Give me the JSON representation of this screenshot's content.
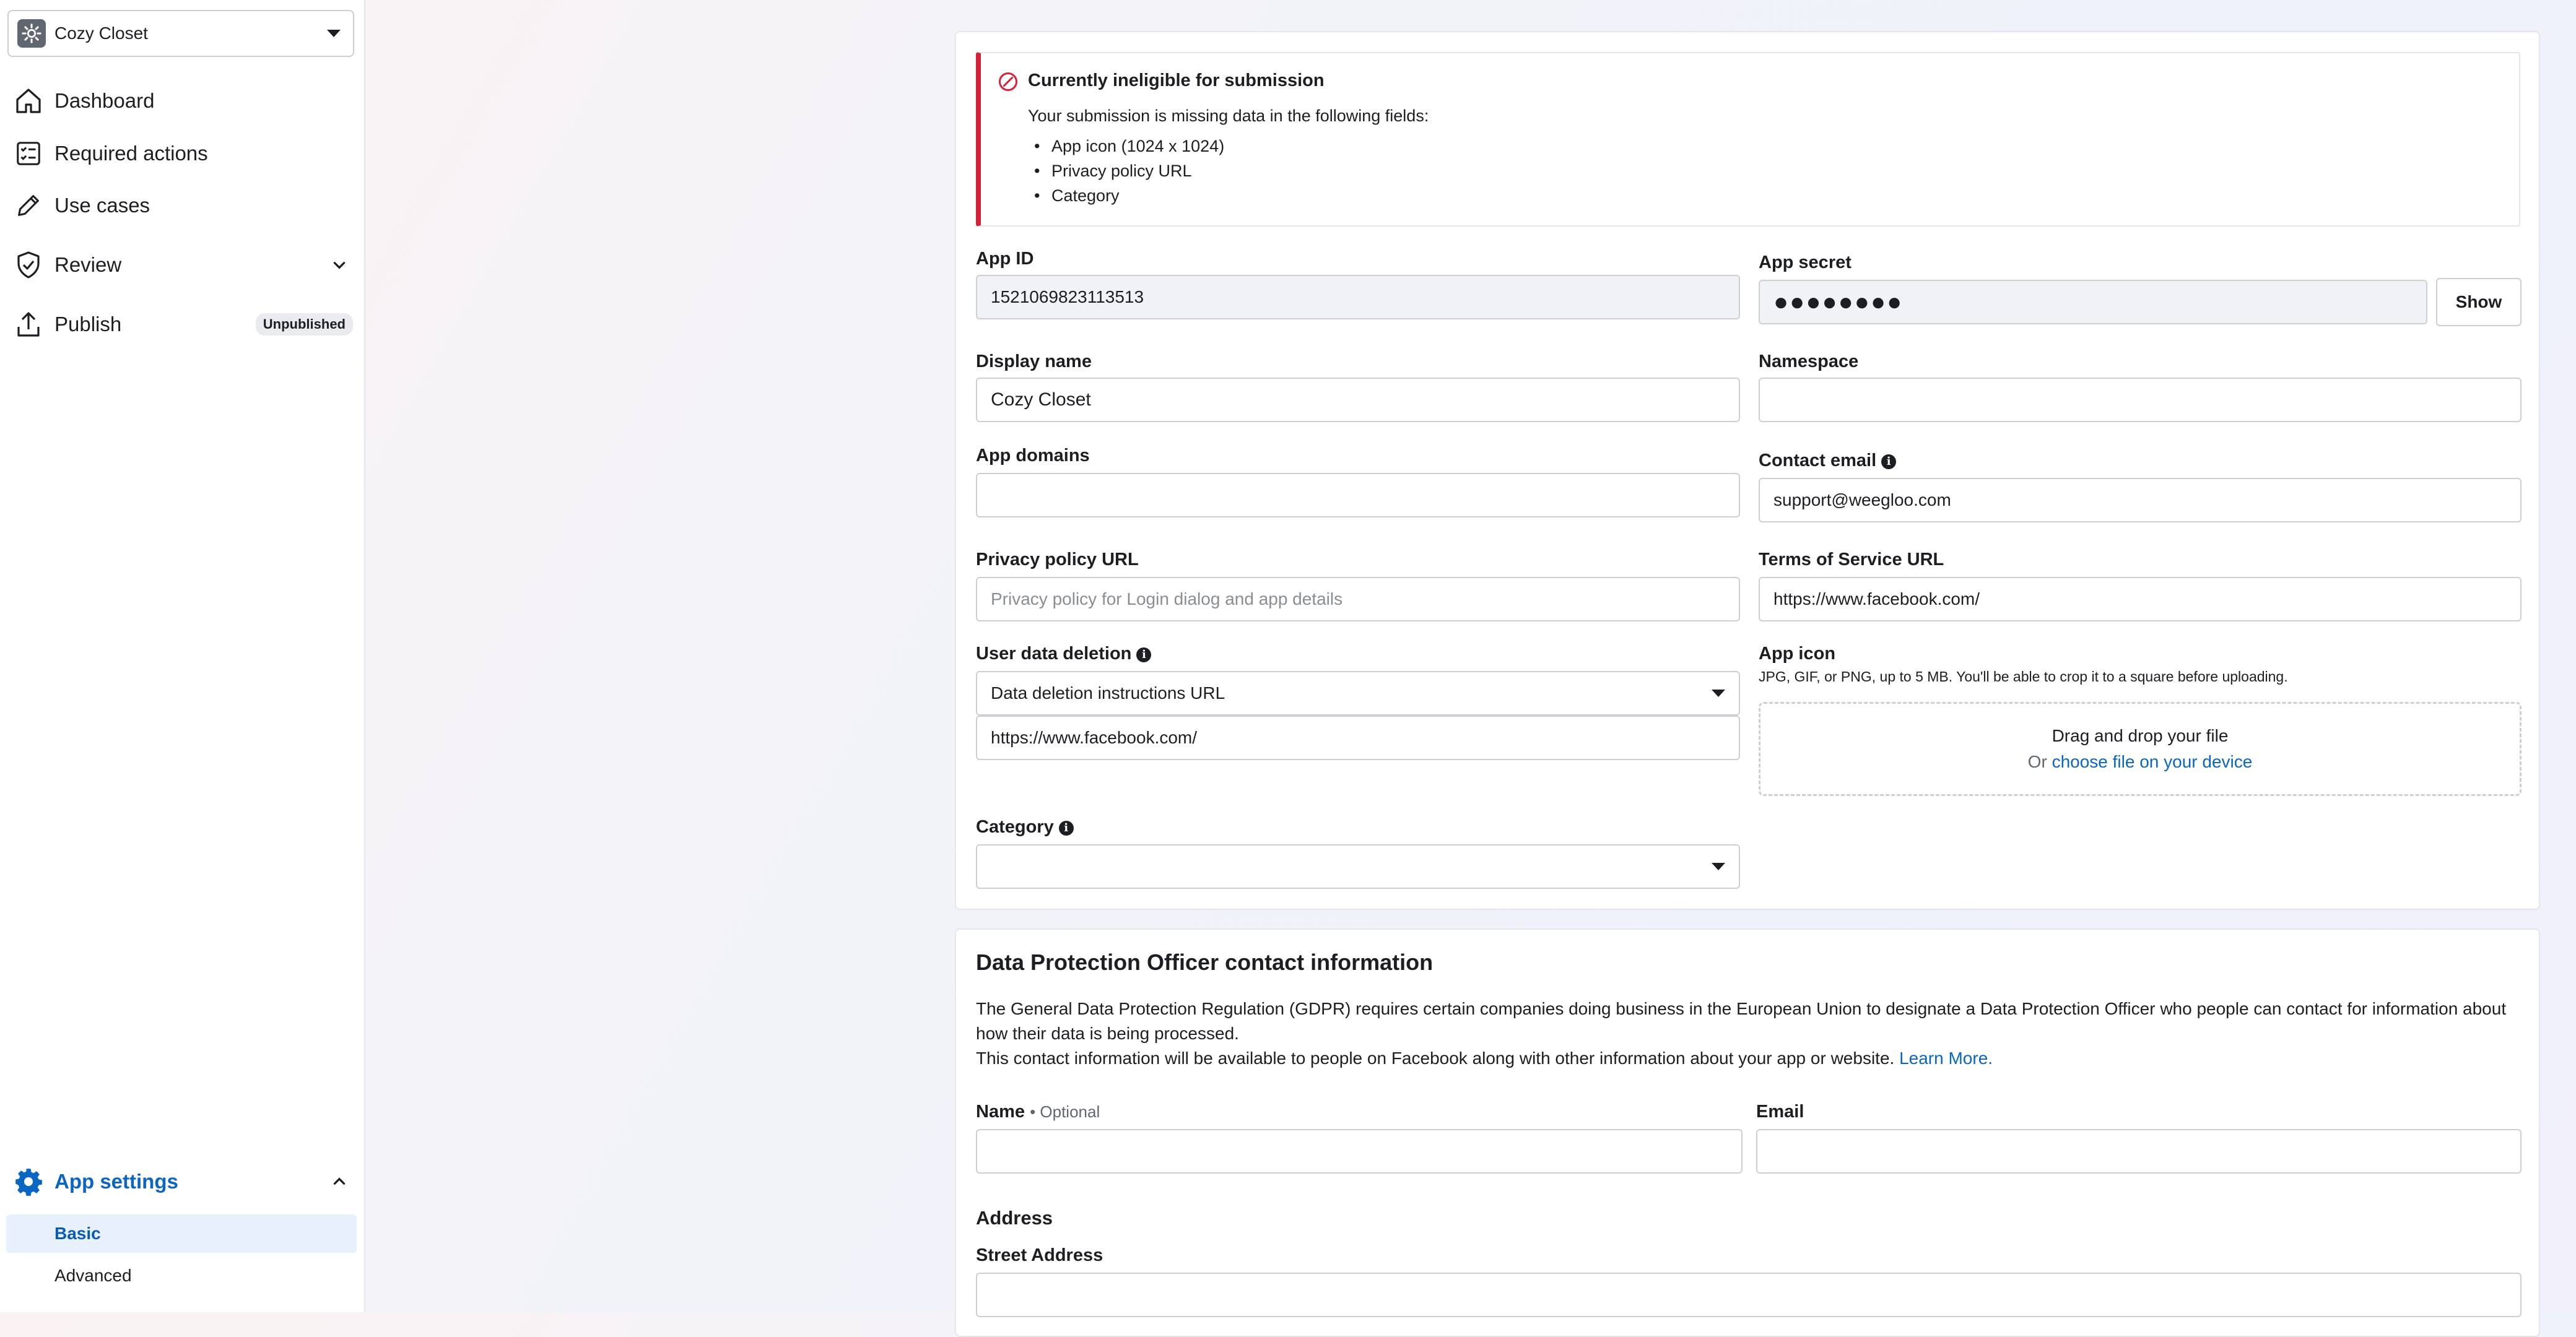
{
  "sidebar": {
    "app_name": "Cozy Closet",
    "nav": [
      {
        "label": "Dashboard",
        "icon": "home-icon"
      },
      {
        "label": "Required actions",
        "icon": "checklist-icon"
      },
      {
        "label": "Use cases",
        "icon": "pencil-icon"
      },
      {
        "label": "Review",
        "icon": "shield-check-icon"
      },
      {
        "label": "Publish",
        "icon": "upload-icon",
        "badge": "Unpublished"
      }
    ],
    "settings": {
      "label": "App settings",
      "items": [
        {
          "label": "Basic",
          "active": true
        },
        {
          "label": "Advanced",
          "active": false
        }
      ]
    }
  },
  "alert": {
    "title": "Currently ineligible for submission",
    "subtitle": "Your submission is missing data in the following fields:",
    "items": [
      "App icon (1024 x 1024)",
      "Privacy policy URL",
      "Category"
    ]
  },
  "form": {
    "app_id": {
      "label": "App ID",
      "value": "1521069823113513"
    },
    "app_secret": {
      "label": "App secret",
      "value": "●●●●●●●●",
      "button": "Show"
    },
    "display_name": {
      "label": "Display name",
      "value": "Cozy Closet"
    },
    "namespace": {
      "label": "Namespace",
      "value": ""
    },
    "app_domains": {
      "label": "App domains",
      "value": ""
    },
    "contact_email": {
      "label": "Contact email",
      "value": "support@weegloo.com"
    },
    "privacy_url": {
      "label": "Privacy policy URL",
      "placeholder": "Privacy policy for Login dialog and app details"
    },
    "tos_url": {
      "label": "Terms of Service URL",
      "value": "https://www.facebook.com/"
    },
    "user_data_deletion": {
      "label": "User data deletion",
      "selected": "Data deletion instructions URL",
      "url": "https://www.facebook.com/"
    },
    "app_icon": {
      "label": "App icon",
      "hint": "JPG, GIF, or PNG, up to 5 MB. You'll be able to crop it to a square before uploading.",
      "drop_text": "Drag and drop your file",
      "or_text": "Or",
      "choose_link": "choose file on your device"
    },
    "category": {
      "label": "Category",
      "selected": ""
    }
  },
  "dpo": {
    "title": "Data Protection Officer contact information",
    "para1": "The General Data Protection Regulation (GDPR) requires certain companies doing business in the European Union to designate a Data Protection Officer who people can contact for information about how their data is being processed.",
    "para2": "This contact information will be available to people on Facebook along with other information about your app or website.",
    "learn_more": "Learn More.",
    "name_label": "Name",
    "optional": "• Optional",
    "email_label": "Email",
    "address_heading": "Address",
    "street_label": "Street Address"
  },
  "colors": {
    "accent": "#0a66c2",
    "error": "#d4213a",
    "active_bg": "#e7f0fb"
  }
}
